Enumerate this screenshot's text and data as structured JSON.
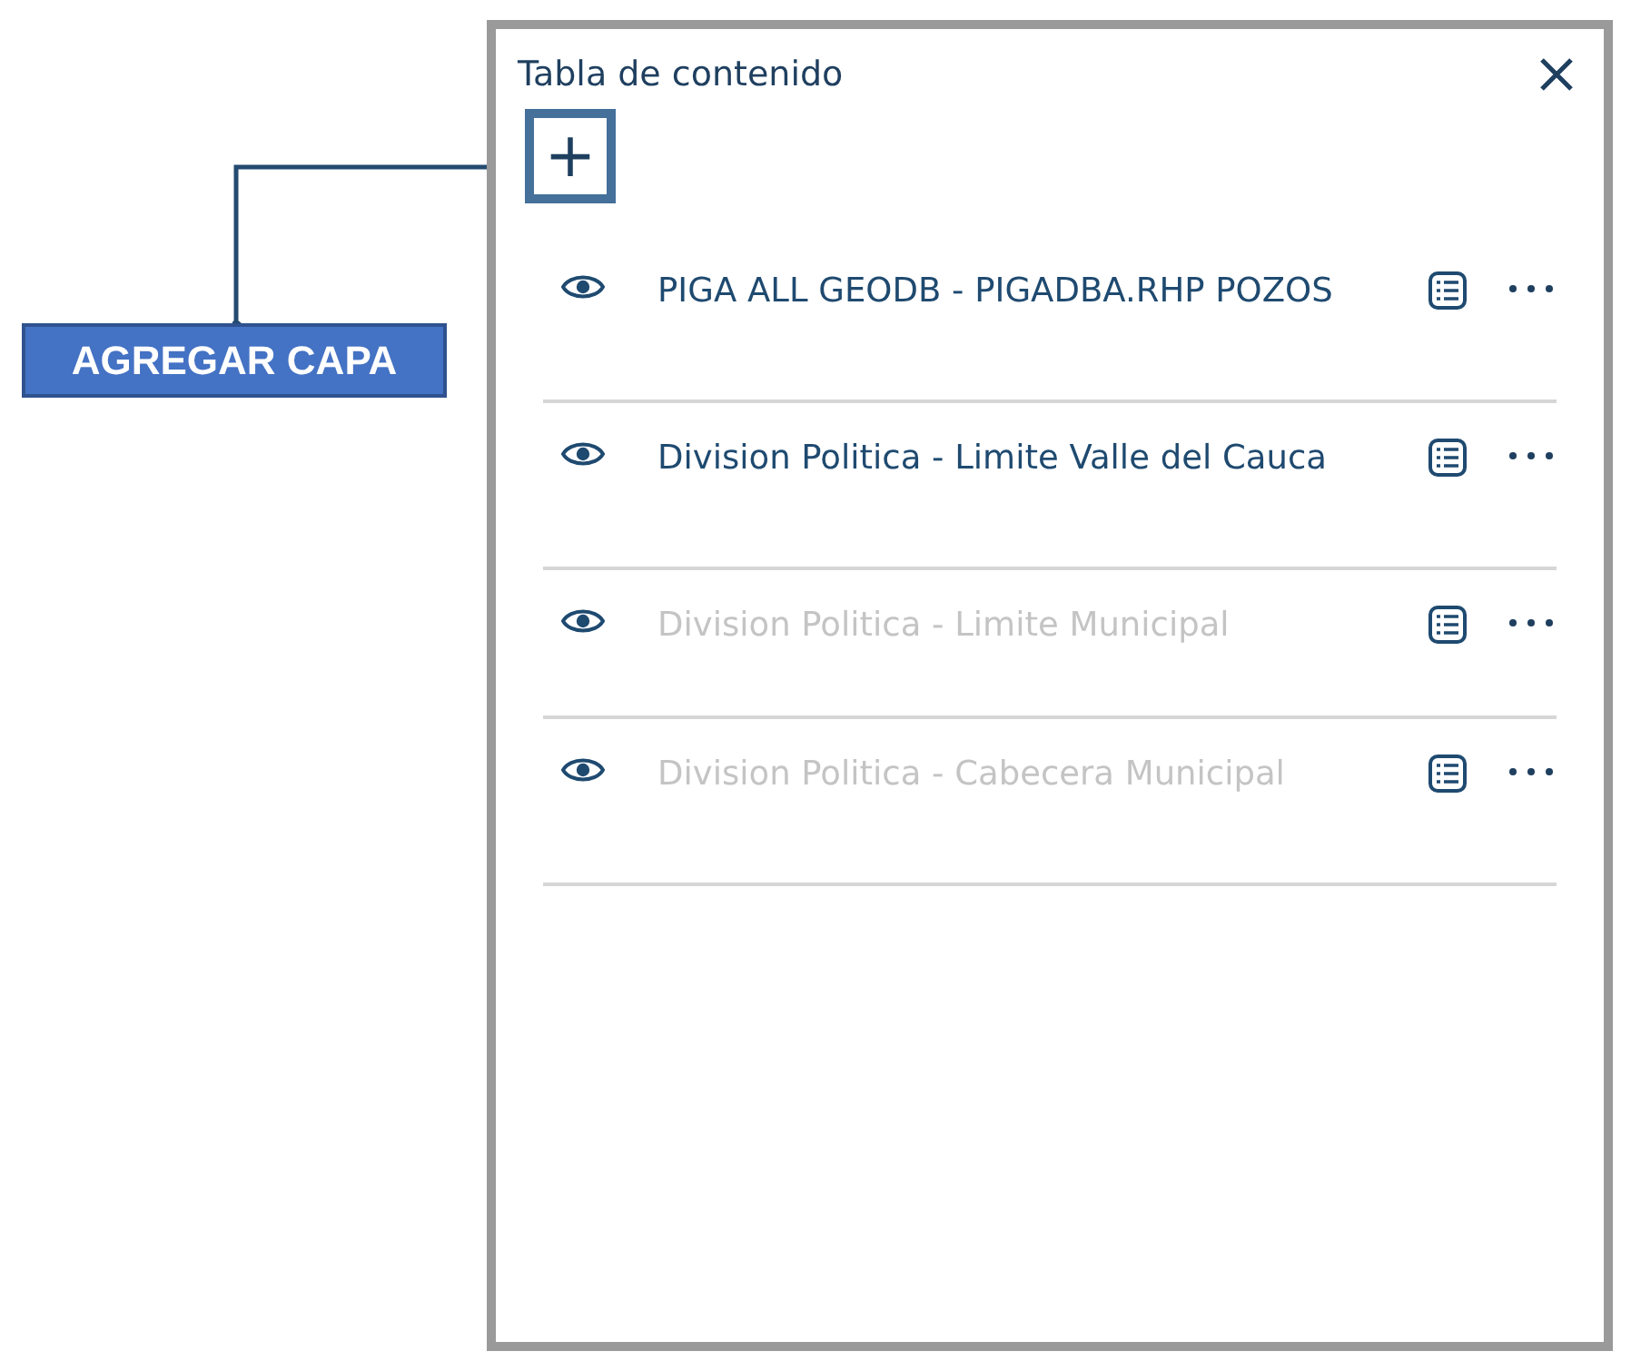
{
  "callout": {
    "label": "AGREGAR CAPA"
  },
  "panel": {
    "title": "Tabla de contenido",
    "add_button": "+",
    "layers": [
      {
        "name": "PIGA ALL GEODB - PIGADBA.RHP POZOS",
        "dimmed": false
      },
      {
        "name": "Division Politica - Limite Valle del Cauca",
        "dimmed": false
      },
      {
        "name": "Division Politica - Limite Municipal",
        "dimmed": true
      },
      {
        "name": "Division Politica - Cabecera Municipal",
        "dimmed": true
      }
    ]
  }
}
